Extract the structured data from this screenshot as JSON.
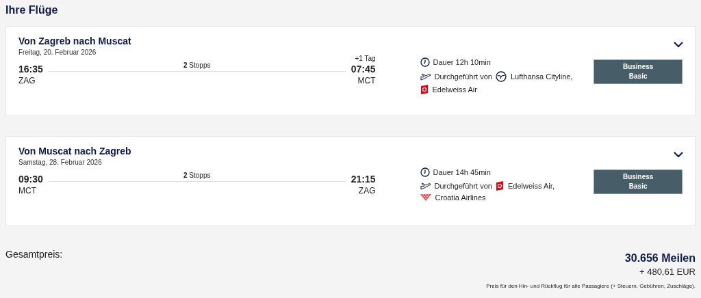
{
  "heading": "Ihre Flüge",
  "flights": [
    {
      "title": "Von Zagreb nach Muscat",
      "date": "Freitag, 20. Februar 2026",
      "dep_time": "16:35",
      "dep_airport": "ZAG",
      "stops": "**2** Stopps",
      "day_offset": "+1 Tag",
      "arr_time": "07:45",
      "arr_airport": "MCT",
      "duration": "Dauer 12h 10min",
      "operated_label": "Durchgeführt von",
      "operators": [
        {
          "kind": "lufthansa",
          "name": "Lufthansa Cityline,"
        },
        {
          "kind": "edelweiss",
          "name": "Edelweiss Air"
        }
      ],
      "fare": "Business Basic",
      "expanded": false
    },
    {
      "title": "Von Muscat nach Zagreb",
      "date": "Samstag, 28. Februar 2026",
      "dep_time": "09:30",
      "dep_airport": "MCT",
      "stops": "**2** Stopps",
      "arr_time": "21:15",
      "arr_airport": "ZAG",
      "duration": "Dauer 14h 45min",
      "operated_label": "Durchgeführt von",
      "operators": [
        {
          "kind": "edelweiss",
          "name": "Edelweiss Air,"
        },
        {
          "kind": "croatia",
          "name": "Croatia Airlines"
        }
      ],
      "fare": "Business Basic",
      "expanded": false
    }
  ],
  "total": {
    "label": "Gesamtpreis:",
    "miles": "30.656 Meilen",
    "cash": "+ 480,61 EUR",
    "note": "Preis für den Hin- und Rückflug für alle Passagiere (+ Steuern, Gebühren, Zuschläge)."
  }
}
